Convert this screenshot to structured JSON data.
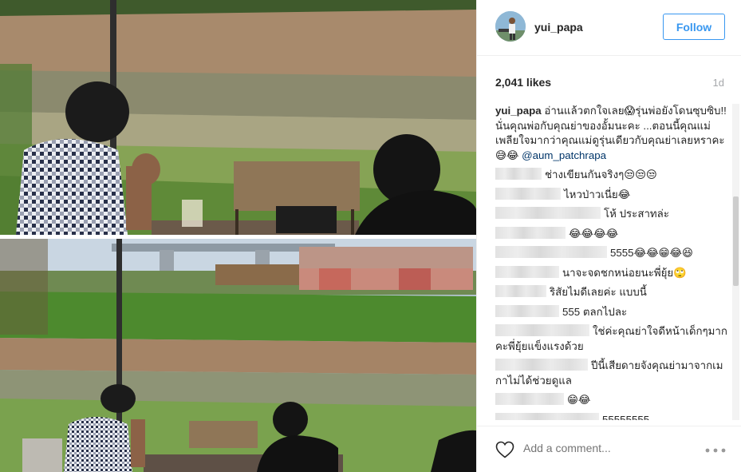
{
  "post": {
    "username": "yui_papa",
    "follow_label": "Follow",
    "likes": "2,041 likes",
    "age": "1d"
  },
  "caption": {
    "user": "yui_papa",
    "text": "อ่านแล้วตกใจเลย😱รุ่นพ่อยังโดนซุบซิบ!! นั่นคุณพ่อกับคุณย่าของอั้มนะคะ ...ตอนนี้คุณแม่เพลียใจมากว่าคุณแม่ดูรุ่นเดียวกับคุณย่าเลยหราคะ 😅😂",
    "mention": "@aum_patchrapa"
  },
  "comments": [
    {
      "text": "ช่างเขียนกันจริงๆ😒😒😒"
    },
    {
      "text": "ไหวป่าวเนี่ย😂"
    },
    {
      "text": "โห้ ประสาทล่ะ"
    },
    {
      "text": "😂😂😂😂"
    },
    {
      "text": "5555😂😂😁😂😆"
    },
    {
      "text": "นาจะจดชกหน่อยนะพี่ยุ้ย🙄"
    },
    {
      "text": "ริสัยไมดีเลยค่ะ แบบนี้"
    },
    {
      "text": "555 ตลกไปละ"
    },
    {
      "text": "ใช่ค่ะคุณย่าใจดีหน้าเด็กๆมากคะพี่ยุ้ยแข็งแรงด้วย"
    },
    {
      "text": "ปีนี้เสียดายจังคุณย่ามาจากเมกาไม่ได้ช่วยดูแล"
    },
    {
      "text": "😁😂"
    },
    {
      "text": "55555555"
    }
  ],
  "add_comment_placeholder": "Add a comment...",
  "icons": {
    "like": "heart-icon",
    "more": "more-options-icon"
  },
  "colors": {
    "accent": "#3897f0",
    "mention": "#003569",
    "muted": "#a5a7aa"
  }
}
